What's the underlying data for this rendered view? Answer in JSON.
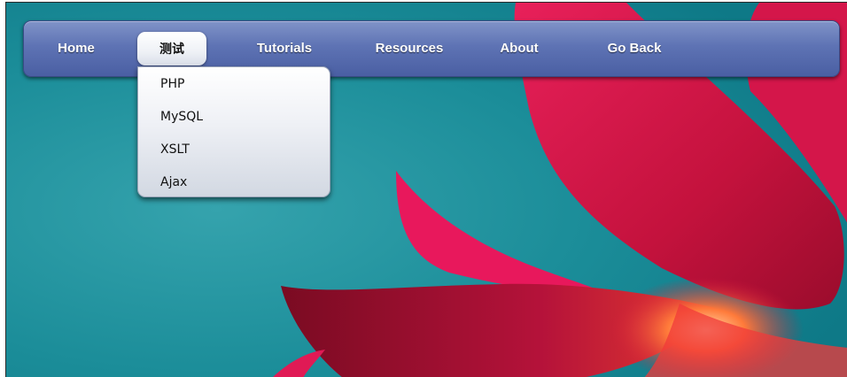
{
  "nav": {
    "items": [
      {
        "label": "Home"
      },
      {
        "label": "测试"
      },
      {
        "label": "Tutorials"
      },
      {
        "label": "Resources"
      },
      {
        "label": "About"
      },
      {
        "label": "Go Back"
      }
    ],
    "active_index": 1
  },
  "dropdown": {
    "items": [
      {
        "label": "PHP"
      },
      {
        "label": "MySQL"
      },
      {
        "label": "XSLT"
      },
      {
        "label": "Ajax"
      }
    ]
  },
  "colors": {
    "navbar_top": "#8093c8",
    "navbar_bottom": "#4a5fa3",
    "background_teal": "#1a8a97",
    "flower_red": "#d21a4a"
  }
}
